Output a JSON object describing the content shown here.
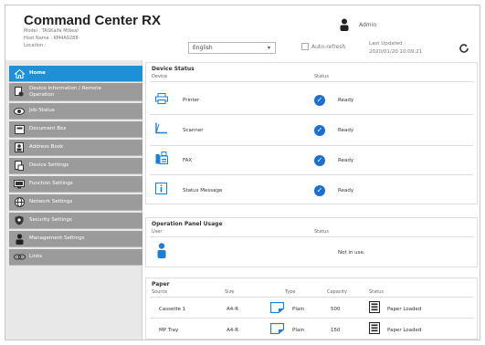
{
  "header": {
    "title": "Command Center RX",
    "model": "Model : TASKalfa Mtkeal",
    "host": "Host Name : KM4A9288",
    "location": "Location :",
    "language": "English",
    "auto_refresh": "Auto-refresh",
    "user": "Admin",
    "last_updated_label": "Last Updated :",
    "last_updated_value": "2020/01/20 10:09:21"
  },
  "sidebar": {
    "items": [
      {
        "label": "Home",
        "icon": "home-icon"
      },
      {
        "label": "Device Information / Remote Operation",
        "icon": "device-info-icon"
      },
      {
        "label": "Job Status",
        "icon": "eye-icon"
      },
      {
        "label": "Document Box",
        "icon": "document-box-icon"
      },
      {
        "label": "Address Book",
        "icon": "address-book-icon"
      },
      {
        "label": "Device Settings",
        "icon": "device-settings-icon"
      },
      {
        "label": "Function Settings",
        "icon": "function-settings-icon"
      },
      {
        "label": "Network Settings",
        "icon": "globe-icon"
      },
      {
        "label": "Security Settings",
        "icon": "shield-icon"
      },
      {
        "label": "Management Settings",
        "icon": "person-icon"
      },
      {
        "label": "Links",
        "icon": "link-icon"
      }
    ]
  },
  "device_status": {
    "title": "Device Status",
    "col_device": "Device",
    "col_status": "Status",
    "rows": [
      {
        "device": "Printer",
        "status": "Ready"
      },
      {
        "device": "Scanner",
        "status": "Ready"
      },
      {
        "device": "FAX",
        "status": "Ready"
      },
      {
        "device": "Status Message",
        "status": "Ready"
      }
    ]
  },
  "panel_usage": {
    "title": "Operation Panel Usage",
    "col_user": "User",
    "col_status": "Status",
    "status": "Not in use."
  },
  "paper": {
    "title": "Paper",
    "cols": {
      "source": "Source",
      "size": "Size",
      "type": "Type",
      "capacity": "Capacity",
      "status": "Status"
    },
    "rows": [
      {
        "source": "Cassette 1",
        "size": "A4-R",
        "type": "Plain",
        "capacity": "500",
        "status": "Paper Loaded"
      },
      {
        "source": "MP Tray",
        "size": "A4-R",
        "type": "Plain",
        "capacity": "150",
        "status": "Paper Loaded"
      }
    ]
  },
  "colors": {
    "accent": "#1f8fd6",
    "nav_bg": "#9b9b9b",
    "check": "#1b6fd0"
  }
}
